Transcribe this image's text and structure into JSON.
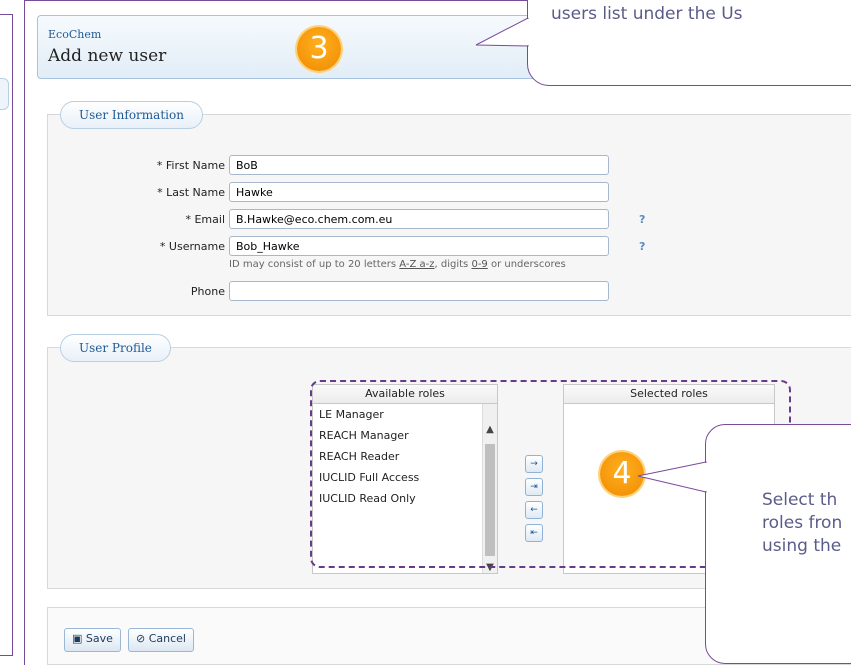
{
  "header": {
    "app_name": "EcoChem",
    "title": "Add new user"
  },
  "steps": {
    "step3": "3",
    "step4": "4"
  },
  "callout_top": {
    "text": "users list under the Us"
  },
  "callout_bottom": {
    "lines": [
      "Select th",
      "roles fron",
      "using the"
    ]
  },
  "user_information": {
    "legend": "User Information",
    "fields": [
      {
        "label": "* First Name",
        "value": "BoB"
      },
      {
        "label": "* Last Name",
        "value": "Hawke"
      },
      {
        "label": "* Email",
        "value": "B.Hawke@eco.chem.com.eu",
        "help": "?"
      },
      {
        "label": "* Username",
        "value": "Bob_Hawke",
        "help": "?"
      },
      {
        "label": "Phone",
        "value": ""
      }
    ],
    "username_hint": {
      "prefix": "ID may consist of up to 20 letters ",
      "letters": "A-Z a-z",
      "mid": ", digits ",
      "digits": "0-9",
      "suffix": " or underscores"
    }
  },
  "user_profile": {
    "legend": "User Profile",
    "available_header": "Available roles",
    "selected_header": "Selected roles",
    "available_roles": [
      "LE Manager",
      "REACH Manager",
      "REACH Reader",
      "IUCLID Full Access",
      "IUCLID Read Only"
    ],
    "move_buttons": [
      "→",
      "⇥",
      "←",
      "⇤"
    ]
  },
  "footer": {
    "save_label": "Save",
    "cancel_label": "Cancel"
  },
  "colors": {
    "accent": "#1d5a95",
    "badge": "#f39200",
    "callout_border": "#7a4a9a"
  }
}
